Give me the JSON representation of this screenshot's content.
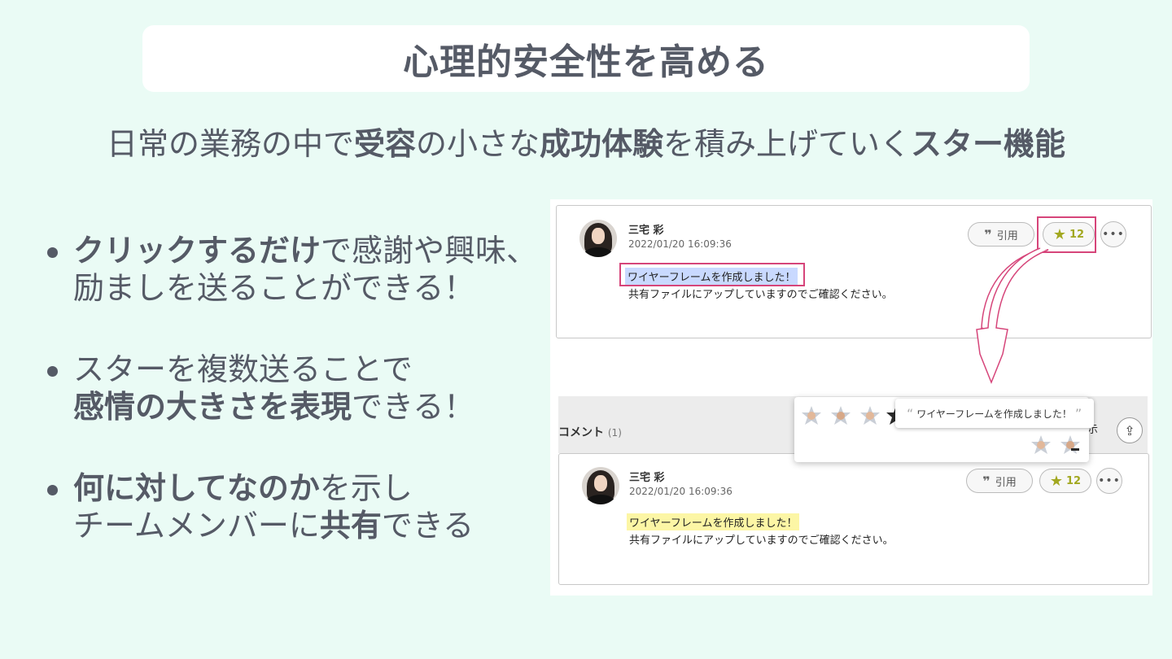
{
  "title": "心理的安全性を高める",
  "subtitle": {
    "p1": "日常の業務の中で",
    "b1": "受容",
    "p2": "の小さな",
    "b2": "成功体験",
    "p3": "を積み上げていく",
    "b3": "スター機能"
  },
  "bullets": [
    {
      "b1": "クリックするだけ",
      "t1": "で感謝や興味、",
      "t2": "励ましを送ることができる！"
    },
    {
      "t1": "スターを複数送ることで",
      "b2": "感情の大きさを表現",
      "t2": "できる！"
    },
    {
      "b1": "何に対してなのか",
      "t1": "を示し",
      "t2": "チームメンバーに",
      "b2": "共有",
      "t3": "できる"
    }
  ],
  "post": {
    "author": "三宅 彩",
    "date": "2022/01/20 16:09:36",
    "line1": "ワイヤーフレームを作成しました！",
    "line2": "共有ファイルにアップしていますのでご確認ください。",
    "quote_label": "引用",
    "star_count": "12",
    "more_label": "•••"
  },
  "comments": {
    "label": "コメント",
    "count": "(1)",
    "tooltip_text": "ワイヤーフレームを作成しました！",
    "partial_text": "示"
  },
  "colors": {
    "background": "#eafbf5",
    "text": "#555a66",
    "accent_frame": "#d6457a",
    "highlight_blue": "#c9d9ff",
    "highlight_yellow": "#fcf6a5",
    "star": "#a2a820"
  }
}
